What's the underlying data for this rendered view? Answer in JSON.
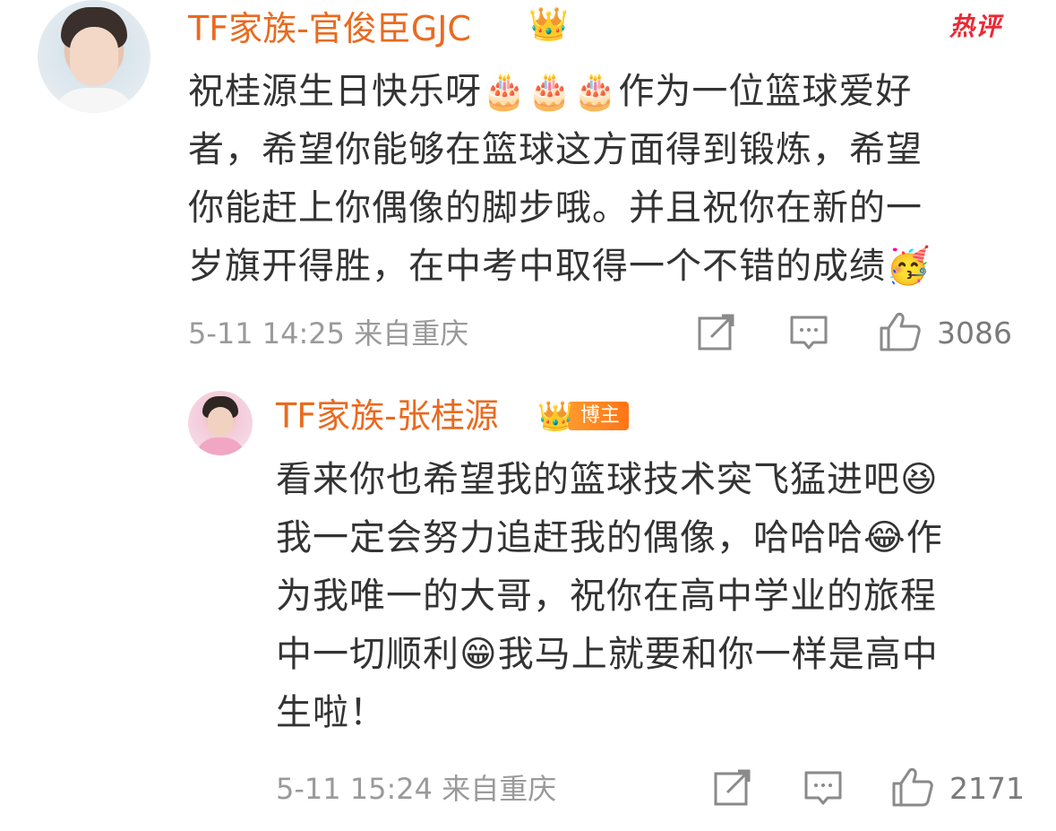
{
  "comment": {
    "username": "TF家族-官俊臣GJC",
    "badge_icon": "crown-icon",
    "hot_label": "热评",
    "text_lines": [
      "祝桂源生日快乐呀🎂🎂🎂作为一位篮球爱好",
      "者，希望你能够在篮球这方面得到锻炼，希望",
      "你能赶上你偶像的脚步哦。并且祝你在新的一",
      "岁旗开得胜，在中考中取得一个不错的成绩🥳"
    ],
    "meta": "5-11 14:25  来自重庆",
    "like_count": "3086"
  },
  "reply": {
    "username": "TF家族-张桂源",
    "badge_label": "博主",
    "text_lines": [
      "看来你也希望我的篮球技术突飞猛进吧😆",
      "我一定会努力追赶我的偶像，哈哈哈😂作",
      "为我唯一的大哥，祝你在高中学业的旅程",
      "中一切顺利😁我马上就要和你一样是高中",
      "生啦！"
    ],
    "meta": "5-11 15:24  来自重庆",
    "like_count": "2171"
  },
  "colors": {
    "username": "#ea6a1f",
    "hot": "#ea2a35",
    "badge": "#ff7a1a",
    "text": "#333333",
    "meta": "#9a9a9a"
  }
}
